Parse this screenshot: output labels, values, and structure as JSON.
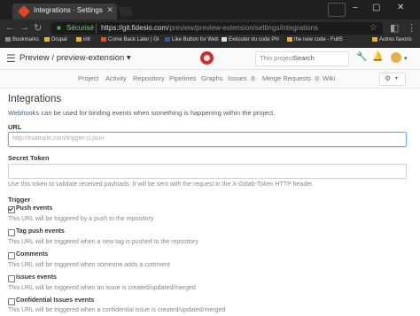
{
  "browser": {
    "tab_title": "Integrations · Settings · P",
    "url_secure": "Sécurisé",
    "url_host": "https://git.fidesio.com",
    "url_path": "/preview/preview-extension/settings/integrations",
    "bookmarks": [
      "Bookmarks",
      "Drupal",
      "intl",
      "Come Back Later | Gi",
      "Like Button for Web",
      "Exécuter du code PH",
      "the new code - FullS",
      "Autres favoris"
    ]
  },
  "header": {
    "project_title": "Preview / preview-extension",
    "search_scope": "This project",
    "search_placeholder": "Search"
  },
  "subnav": {
    "items": [
      "Project",
      "Activity",
      "Repository",
      "Pipelines",
      "Graphs",
      "Issues",
      "Merge Requests",
      "Wiki"
    ],
    "issues_count": "0",
    "mr_count": "0"
  },
  "main": {
    "title": "Integrations",
    "desc_link": "Webhooks",
    "desc_rest": " can be used for binding events when something is happening within the project.",
    "url_label": "URL",
    "url_placeholder": "http://example.com/trigger-ci.json",
    "token_label": "Secret Token",
    "token_help": "Use this token to validate received payloads. It will be sent with the request in the X-Gitlab-Token HTTP header.",
    "trigger_label": "Trigger",
    "triggers": [
      {
        "label": "Push events",
        "help": "This URL will be triggered by a push to the repository",
        "checked": true
      },
      {
        "label": "Tag push events",
        "help": "This URL will be triggered when a new tag is pushed to the repository",
        "checked": false
      },
      {
        "label": "Comments",
        "help": "This URL will be triggered when someone adds a comment",
        "checked": false
      },
      {
        "label": "Issues events",
        "help": "This URL will be triggered when an issue is created/updated/merged",
        "checked": false
      },
      {
        "label": "Confidential Issues events",
        "help": "This URL will be triggered when a confidential issue is created/updated/merged",
        "checked": false
      }
    ]
  },
  "colors": {
    "link": "#1b69b6",
    "brand": "#c9302c"
  }
}
